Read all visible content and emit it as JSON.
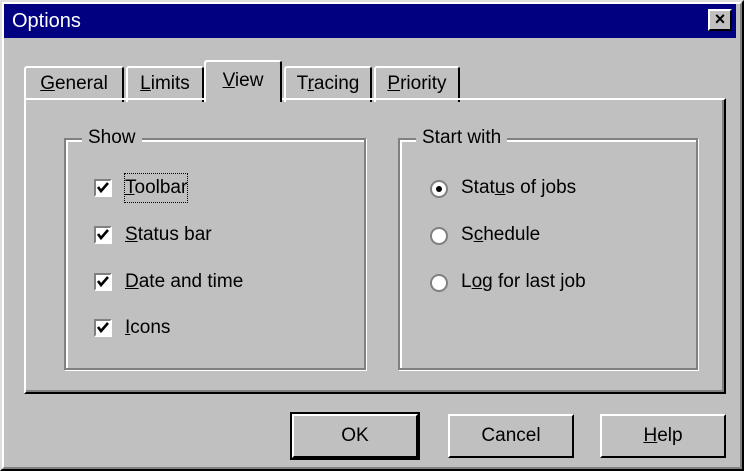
{
  "window": {
    "title": "Options",
    "close_glyph": "×"
  },
  "tabs": [
    {
      "label_pre": "",
      "accel": "G",
      "label_post": "eneral",
      "active": false
    },
    {
      "label_pre": "",
      "accel": "L",
      "label_post": "imits",
      "active": false
    },
    {
      "label_pre": "",
      "accel": "V",
      "label_post": "iew",
      "active": true
    },
    {
      "label_pre": "T",
      "accel": "r",
      "label_post": "acing",
      "active": false
    },
    {
      "label_pre": "",
      "accel": "P",
      "label_post": "riority",
      "active": false
    }
  ],
  "show_group": {
    "title": "Show",
    "items": [
      {
        "accel": "T",
        "rest": "oolbar",
        "checked": true
      },
      {
        "accel": "S",
        "rest": "tatus bar",
        "checked": true
      },
      {
        "accel": "D",
        "rest": "ate and time",
        "checked": true
      },
      {
        "accel": "I",
        "rest": "cons",
        "checked": true
      }
    ]
  },
  "start_group": {
    "title": "Start with",
    "items": [
      {
        "pre": "Stat",
        "accel": "u",
        "rest": "s of jobs",
        "selected": true
      },
      {
        "pre": "S",
        "accel": "c",
        "rest": "hedule",
        "selected": false
      },
      {
        "pre": "L",
        "accel": "o",
        "rest": "g for last job",
        "selected": false
      }
    ]
  },
  "buttons": {
    "ok": "OK",
    "cancel": "Cancel",
    "help_accel": "H",
    "help_rest": "elp"
  }
}
